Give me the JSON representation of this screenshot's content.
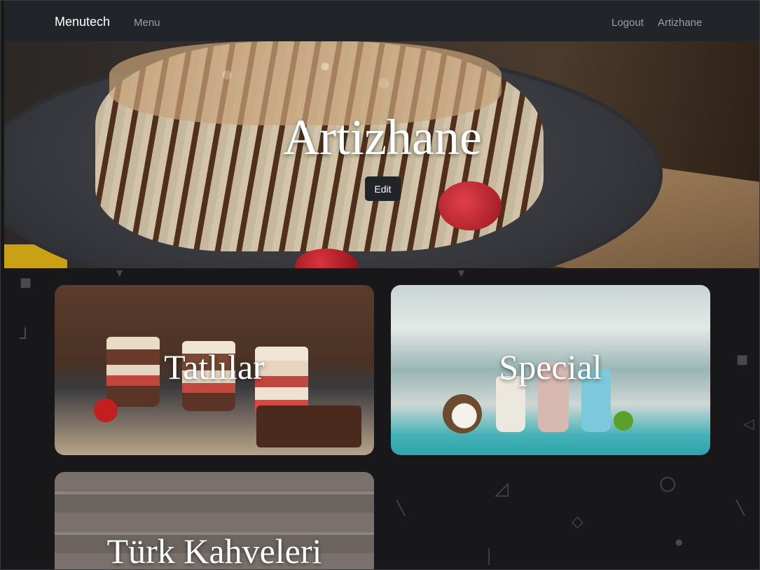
{
  "navbar": {
    "brand": "Menutech",
    "menu_label": "Menu",
    "logout_label": "Logout",
    "user_label": "Artizhane"
  },
  "hero": {
    "title": "Artizhane",
    "edit_label": "Edit"
  },
  "categories": [
    {
      "title": "Tatlılar"
    },
    {
      "title": "Special"
    },
    {
      "title": "Türk Kahveleri"
    }
  ],
  "colors": {
    "navbar_bg": "#212529",
    "page_bg": "#18181a",
    "edit_button_bg": "#212529"
  }
}
